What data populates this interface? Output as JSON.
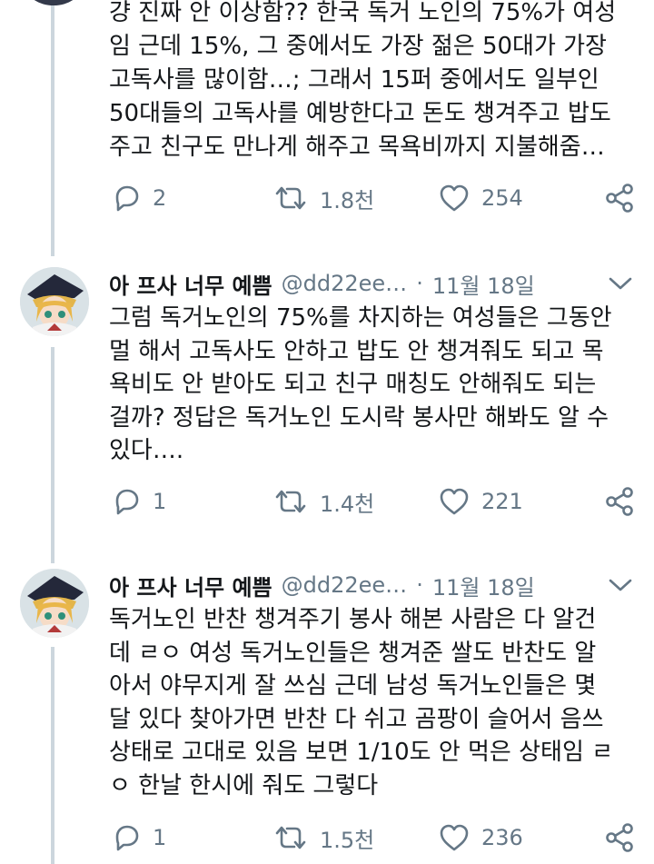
{
  "colors": {
    "text": "#14171a",
    "muted": "#657786",
    "thread_line": "#ccd6dd",
    "background": "#ffffff"
  },
  "tweets": [
    {
      "partial": true,
      "text": "걍 진짜 안 이상함?? 한국 독거 노인의 75%가 여성\n임 근데 15%, 그 중에서도 가장 젊은 50대가 가장\n고독사를 많이함…; 그래서 15퍼 중에서도 일부인\n50대들의 고독사를 예방한다고 돈도 챙겨주고 밥도\n주고 친구도 만나게 해주고 목욕비까지 지불해줌…",
      "actions": {
        "reply_count": "2",
        "retweet_count": "1.8천",
        "like_count": "254",
        "reply_icon": "reply-icon",
        "retweet_icon": "retweet-icon",
        "like_icon": "heart-icon",
        "share_icon": "share-icon"
      }
    },
    {
      "display_name": "아 프사 너무 예쁨",
      "handle": "@dd22ee…",
      "separator": "·",
      "date": "11월 18일",
      "text": "그럼 독거노인의 75%를 차지하는 여성들은 그동안\n멀 해서 고독사도 안하고 밥도 안 챙겨줘도 되고 목\n욕비도 안 받아도 되고 친구 매칭도 안해줘도 되는\n걸까? 정답은 독거노인 도시락 봉사만 해봐도 알 수\n있다….",
      "actions": {
        "reply_count": "1",
        "retweet_count": "1.4천",
        "like_count": "221"
      }
    },
    {
      "display_name": "아 프사 너무 예쁨",
      "handle": "@dd22ee…",
      "separator": "·",
      "date": "11월 18일",
      "text": "독거노인 반찬 챙겨주기 봉사 해본 사람은 다 알건\n데 ㄹㅇ 여성 독거노인들은 챙겨준 쌀도 반찬도 알\n아서 야무지게 잘 쓰심 근데 남성 독거노인들은 몇\n달 있다 찾아가면 반찬 다 쉬고 곰팡이 슬어서 음쓰\n상태로 고대로 있음 보면 1/10도 안 먹은 상태임 ㄹ\nㅇ 한날 한시에 줘도 그렇다",
      "actions": {
        "reply_count": "1",
        "retweet_count": "1.5천",
        "like_count": "236"
      }
    }
  ]
}
